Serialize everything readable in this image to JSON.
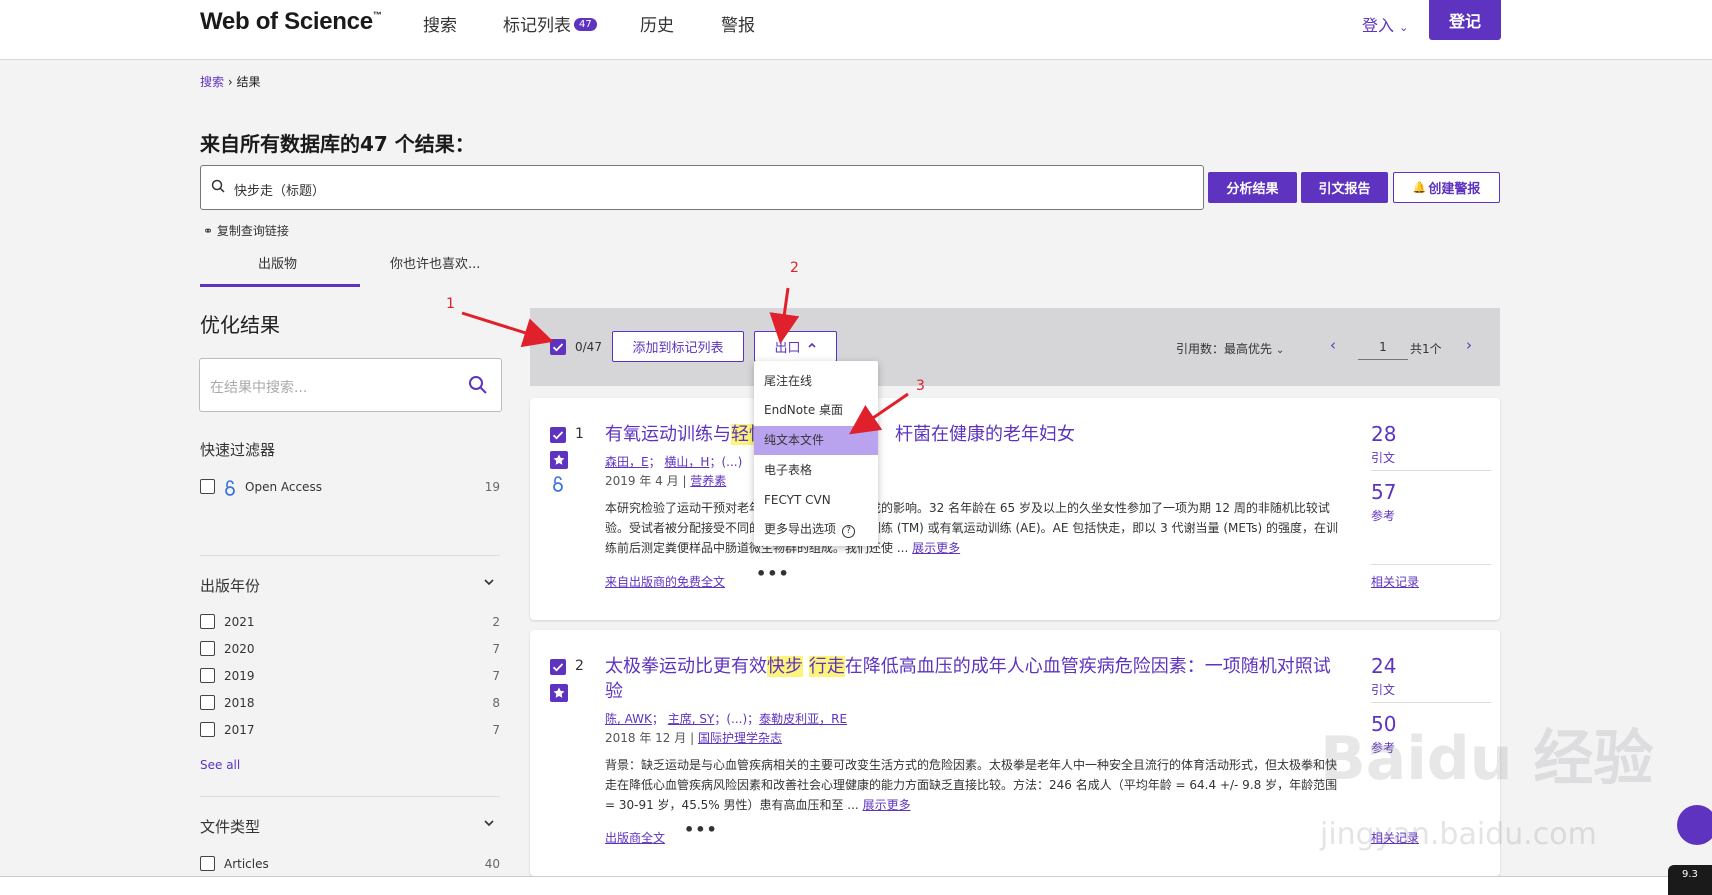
{
  "header": {
    "logo": "Web of Science",
    "logo_tm": "™",
    "nav": [
      {
        "label": "搜索"
      },
      {
        "label": "标记列表",
        "badge": "47"
      },
      {
        "label": "历史"
      },
      {
        "label": "警报"
      }
    ],
    "login_link": "登入",
    "register_btn": "登记"
  },
  "breadcrumb": {
    "link": "搜索",
    "separator": "›",
    "current": "结果"
  },
  "page_title": "来自所有数据库的47 个结果：",
  "search": {
    "query": "快步走（标题）"
  },
  "actions": {
    "analyze": "分析结果",
    "citation_report": "引文报告",
    "create_alert": "创建警报"
  },
  "copy_query_link": "复制查询链接",
  "tabs": [
    {
      "label": "出版物"
    },
    {
      "label": "你也许也喜欢..."
    }
  ],
  "sidebar": {
    "title": "优化结果",
    "search_placeholder": "在结果中搜索...",
    "quick_filters": {
      "heading": "快速过滤器",
      "items": [
        {
          "label": "Open Access",
          "count": "19"
        }
      ]
    },
    "pub_year": {
      "heading": "出版年份",
      "items": [
        {
          "label": "2021",
          "count": "2"
        },
        {
          "label": "2020",
          "count": "7"
        },
        {
          "label": "2019",
          "count": "7"
        },
        {
          "label": "2018",
          "count": "8"
        },
        {
          "label": "2017",
          "count": "7"
        }
      ],
      "see_all": "See all"
    },
    "doc_type": {
      "heading": "文件类型",
      "items": [
        {
          "label": "Articles",
          "count": "40"
        }
      ]
    }
  },
  "toolbar": {
    "selected": "0/47",
    "add_to_list": "添加到标记列表",
    "export": "出口",
    "sort": "引用数：最高优先",
    "page": "1",
    "total": "共1个"
  },
  "export_menu": [
    "尾注在线",
    "EndNote 桌面",
    "纯文本文件",
    "电子表格",
    "FECYT CVN",
    "更多导出选项"
  ],
  "annotations": [
    "1",
    "2",
    "3"
  ],
  "results": [
    {
      "num": "1",
      "title_a": "有氧运动训练与",
      "title_hl": "轻快",
      "title_b": "",
      "title_c": "杆菌在健康的老年妇女",
      "authors": [
        "森田，E",
        "横山，H"
      ],
      "authors_more": "(...)",
      "date": "2019 年 4 月",
      "journal": "营养素",
      "abstract": "本研究检验了运动干预对老年妇女肠道微生物群组成的影响。32 名年龄在 65 岁及以上的久坐女性参加了一项为期 12 周的非随机比较试验。受试者被分配接受不同的运动干预、躯干肌肉训练 (TM) 或有氧运动训练 (AE)。AE 包括快走，即以 3 代谢当量 (METs) 的强度，在训练前后测定粪便样品中肠道微生物群的组成。我们还使 ...",
      "show_more": "展示更多",
      "fulltext": "来自出版商的免费全文",
      "citations": "28",
      "citations_lbl": "引文",
      "refs": "57",
      "refs_lbl": "参考",
      "related": "相关记录"
    },
    {
      "num": "2",
      "title_a": "太极拳运动比更有效",
      "title_hl": "快步",
      "title_hl2": "行走",
      "title_b": "在降低高血压的成年人心血管疾病危险因素：一项随机对照试验",
      "authors": [
        "陈, AWK",
        "主席, SY"
      ],
      "authors_more": "(...)",
      "authors_last": "泰勒皮利亚，RE",
      "date": "2018 年 12 月",
      "journal": "国际护理学杂志",
      "abstract": "背景：缺乏运动是与心血管疾病相关的主要可改变生活方式的危险因素。太极拳是老年人中一种安全且流行的体育活动形式，但太极拳和快走在降低心血管疾病风险因素和改善社会心理健康的能力方面缺乏直接比较。方法：246 名成人（平均年龄 = 64.4 +/- 9.8 岁，年龄范围 = 30-91 岁，45.5% 男性）患有高血压和至 ...",
      "show_more": "展示更多",
      "fulltext": "出版商全文",
      "citations": "24",
      "citations_lbl": "引文",
      "refs": "50",
      "refs_lbl": "参考",
      "related": "相关记录"
    }
  ],
  "watermark": {
    "brand": "Baidu 经验",
    "url": "jingyan.baidu.com"
  },
  "widget": {
    "badge": "9.3"
  }
}
